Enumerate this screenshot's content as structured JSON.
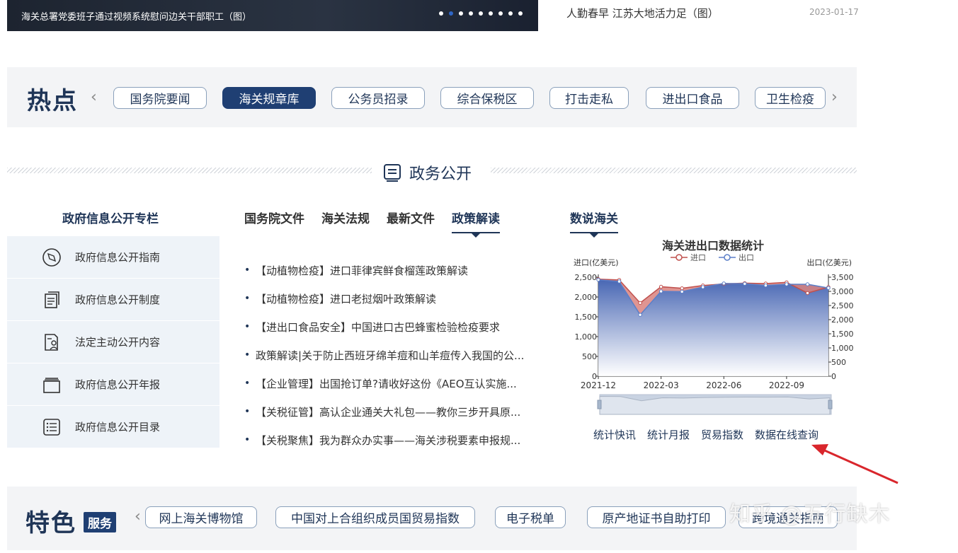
{
  "banner": {
    "caption": "海关总署党委班子通过视频系统慰问边关干部职工（图）",
    "dot_count": 9,
    "active_dot": 1
  },
  "top_news": {
    "title": "人勤春早 江苏大地活力足（图）",
    "date": "2023-01-17"
  },
  "hotspot": {
    "title": "热点",
    "prev_arrow": "‹",
    "next_arrow": "›",
    "items": [
      "国务院要闻",
      "海关规章库",
      "公务员招录",
      "综合保税区",
      "打击走私",
      "进出口食品",
      "卫生检疫"
    ],
    "active_index": 1
  },
  "section": {
    "title": "政务公开",
    "icon": "list-document-icon"
  },
  "left_column": {
    "title": "政府信息公开专栏",
    "items": [
      {
        "label": "政府信息公开指南",
        "icon": "compass-icon"
      },
      {
        "label": "政府信息公开制度",
        "icon": "documents-icon"
      },
      {
        "label": "法定主动公开内容",
        "icon": "person-document-icon"
      },
      {
        "label": "政府信息公开年报",
        "icon": "folder-icon"
      },
      {
        "label": "政府信息公开目录",
        "icon": "list-icon"
      }
    ]
  },
  "middle_column": {
    "tabs": [
      "国务院文件",
      "海关法规",
      "最新文件",
      "政策解读"
    ],
    "active_tab": 3,
    "bullet": "•",
    "articles": [
      "【动植物检疫】进口菲律宾鲜食榴莲政策解读",
      "【动植物检疫】进口老挝烟叶政策解读",
      "【进出口食品安全】中国进口古巴蜂蜜检验检疫要求",
      "政策解读|关于防止西班牙绵羊痘和山羊痘传入我国的公...",
      "【企业管理】出国抢订单?请收好这份《AEO互认实施...",
      "【关税征管】高认企业通关大礼包——教你三步开具原...",
      "【关税聚焦】我为群众办实事——海关涉税要素申报规..."
    ]
  },
  "right_column": {
    "tab": "数说海关",
    "links": [
      "统计快讯",
      "统计月报",
      "贸易指数",
      "数据在线查询"
    ]
  },
  "chart_data": {
    "type": "area",
    "title": "海关进出口数据统计",
    "left_axis_label": "进口(亿美元)",
    "right_axis_label": "出口(亿美元)",
    "legend_position": "top-center",
    "x_tick_labels": [
      "2021-12",
      "2022-03",
      "2022-06",
      "2022-09"
    ],
    "left_ticks": [
      "0",
      "500",
      "1,000",
      "1,500",
      "2,000",
      "2,500"
    ],
    "right_ticks": [
      "0",
      "500",
      "1,000",
      "1,500",
      "2,000",
      "2,500",
      "3,000",
      "3,500"
    ],
    "ylim_left": [
      0,
      2500
    ],
    "ylim_right": [
      0,
      3500
    ],
    "grid": false,
    "series": [
      {
        "name": "进口",
        "axis": "left",
        "color": "#c0504d",
        "values": [
          2450,
          2430,
          1850,
          2260,
          2220,
          2290,
          2330,
          2350,
          2340,
          2370,
          2100,
          2250
        ]
      },
      {
        "name": "出口",
        "axis": "right",
        "color": "#5b7fc8",
        "values": [
          3410,
          3350,
          2170,
          3000,
          2990,
          3150,
          3280,
          3270,
          3210,
          3250,
          3250,
          3120
        ]
      }
    ],
    "colors": {
      "fill_top": "#3f5fb0",
      "fill_bottom": "#ffffff",
      "import_fill": "#d9827f"
    }
  },
  "features": {
    "title": "特色",
    "badge": "服务",
    "prev_arrow": "‹",
    "items": [
      "网上海关博物馆",
      "中国对上合组织成员国贸易指数",
      "电子税单",
      "原产地证书自助打印",
      "跨境通关指南"
    ]
  },
  "watermark": "知乎 @五行缺木"
}
